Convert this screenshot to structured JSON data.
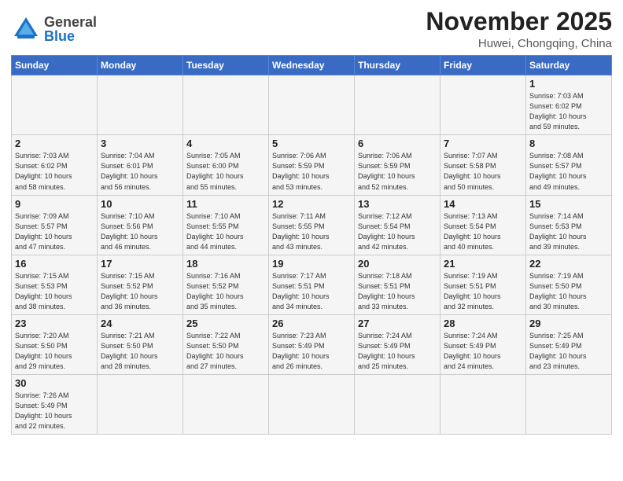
{
  "header": {
    "logo_general": "General",
    "logo_blue": "Blue",
    "month_year": "November 2025",
    "location": "Huwei, Chongqing, China"
  },
  "weekdays": [
    "Sunday",
    "Monday",
    "Tuesday",
    "Wednesday",
    "Thursday",
    "Friday",
    "Saturday"
  ],
  "weeks": [
    [
      {
        "day": "",
        "info": ""
      },
      {
        "day": "",
        "info": ""
      },
      {
        "day": "",
        "info": ""
      },
      {
        "day": "",
        "info": ""
      },
      {
        "day": "",
        "info": ""
      },
      {
        "day": "",
        "info": ""
      },
      {
        "day": "1",
        "info": "Sunrise: 7:03 AM\nSunset: 6:02 PM\nDaylight: 10 hours\nand 59 minutes."
      }
    ],
    [
      {
        "day": "2",
        "info": "Sunrise: 7:03 AM\nSunset: 6:02 PM\nDaylight: 10 hours\nand 58 minutes."
      },
      {
        "day": "3",
        "info": "Sunrise: 7:04 AM\nSunset: 6:01 PM\nDaylight: 10 hours\nand 56 minutes."
      },
      {
        "day": "4",
        "info": "Sunrise: 7:05 AM\nSunset: 6:00 PM\nDaylight: 10 hours\nand 55 minutes."
      },
      {
        "day": "5",
        "info": "Sunrise: 7:06 AM\nSunset: 5:59 PM\nDaylight: 10 hours\nand 53 minutes."
      },
      {
        "day": "6",
        "info": "Sunrise: 7:06 AM\nSunset: 5:59 PM\nDaylight: 10 hours\nand 52 minutes."
      },
      {
        "day": "7",
        "info": "Sunrise: 7:07 AM\nSunset: 5:58 PM\nDaylight: 10 hours\nand 50 minutes."
      },
      {
        "day": "8",
        "info": "Sunrise: 7:08 AM\nSunset: 5:57 PM\nDaylight: 10 hours\nand 49 minutes."
      }
    ],
    [
      {
        "day": "9",
        "info": "Sunrise: 7:09 AM\nSunset: 5:57 PM\nDaylight: 10 hours\nand 47 minutes."
      },
      {
        "day": "10",
        "info": "Sunrise: 7:10 AM\nSunset: 5:56 PM\nDaylight: 10 hours\nand 46 minutes."
      },
      {
        "day": "11",
        "info": "Sunrise: 7:10 AM\nSunset: 5:55 PM\nDaylight: 10 hours\nand 44 minutes."
      },
      {
        "day": "12",
        "info": "Sunrise: 7:11 AM\nSunset: 5:55 PM\nDaylight: 10 hours\nand 43 minutes."
      },
      {
        "day": "13",
        "info": "Sunrise: 7:12 AM\nSunset: 5:54 PM\nDaylight: 10 hours\nand 42 minutes."
      },
      {
        "day": "14",
        "info": "Sunrise: 7:13 AM\nSunset: 5:54 PM\nDaylight: 10 hours\nand 40 minutes."
      },
      {
        "day": "15",
        "info": "Sunrise: 7:14 AM\nSunset: 5:53 PM\nDaylight: 10 hours\nand 39 minutes."
      }
    ],
    [
      {
        "day": "16",
        "info": "Sunrise: 7:15 AM\nSunset: 5:53 PM\nDaylight: 10 hours\nand 38 minutes."
      },
      {
        "day": "17",
        "info": "Sunrise: 7:15 AM\nSunset: 5:52 PM\nDaylight: 10 hours\nand 36 minutes."
      },
      {
        "day": "18",
        "info": "Sunrise: 7:16 AM\nSunset: 5:52 PM\nDaylight: 10 hours\nand 35 minutes."
      },
      {
        "day": "19",
        "info": "Sunrise: 7:17 AM\nSunset: 5:51 PM\nDaylight: 10 hours\nand 34 minutes."
      },
      {
        "day": "20",
        "info": "Sunrise: 7:18 AM\nSunset: 5:51 PM\nDaylight: 10 hours\nand 33 minutes."
      },
      {
        "day": "21",
        "info": "Sunrise: 7:19 AM\nSunset: 5:51 PM\nDaylight: 10 hours\nand 32 minutes."
      },
      {
        "day": "22",
        "info": "Sunrise: 7:19 AM\nSunset: 5:50 PM\nDaylight: 10 hours\nand 30 minutes."
      }
    ],
    [
      {
        "day": "23",
        "info": "Sunrise: 7:20 AM\nSunset: 5:50 PM\nDaylight: 10 hours\nand 29 minutes."
      },
      {
        "day": "24",
        "info": "Sunrise: 7:21 AM\nSunset: 5:50 PM\nDaylight: 10 hours\nand 28 minutes."
      },
      {
        "day": "25",
        "info": "Sunrise: 7:22 AM\nSunset: 5:50 PM\nDaylight: 10 hours\nand 27 minutes."
      },
      {
        "day": "26",
        "info": "Sunrise: 7:23 AM\nSunset: 5:49 PM\nDaylight: 10 hours\nand 26 minutes."
      },
      {
        "day": "27",
        "info": "Sunrise: 7:24 AM\nSunset: 5:49 PM\nDaylight: 10 hours\nand 25 minutes."
      },
      {
        "day": "28",
        "info": "Sunrise: 7:24 AM\nSunset: 5:49 PM\nDaylight: 10 hours\nand 24 minutes."
      },
      {
        "day": "29",
        "info": "Sunrise: 7:25 AM\nSunset: 5:49 PM\nDaylight: 10 hours\nand 23 minutes."
      }
    ],
    [
      {
        "day": "30",
        "info": "Sunrise: 7:26 AM\nSunset: 5:49 PM\nDaylight: 10 hours\nand 22 minutes."
      },
      {
        "day": "",
        "info": ""
      },
      {
        "day": "",
        "info": ""
      },
      {
        "day": "",
        "info": ""
      },
      {
        "day": "",
        "info": ""
      },
      {
        "day": "",
        "info": ""
      },
      {
        "day": "",
        "info": ""
      }
    ]
  ]
}
